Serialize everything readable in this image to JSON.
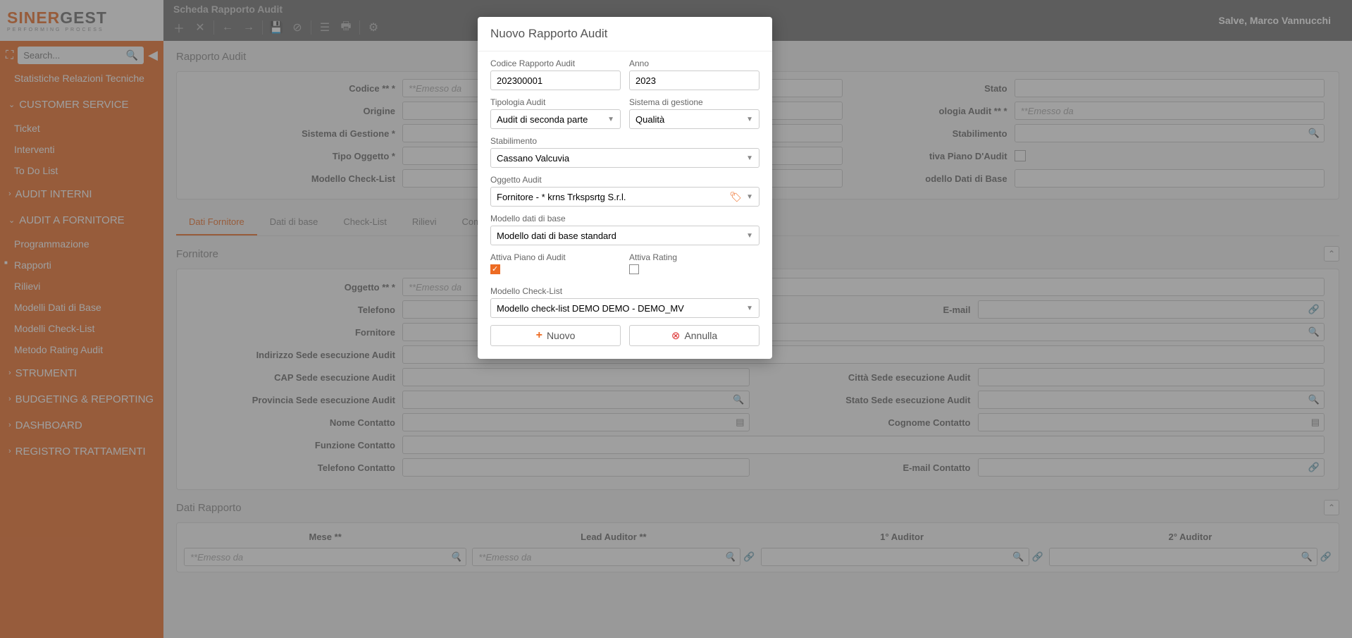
{
  "logo": {
    "part1": "SINER",
    "part2": "GEST",
    "sub": "PERFORMING PROCESS"
  },
  "search_placeholder": "Search...",
  "greeting": "Salve, Marco Vannucchi",
  "topbar_title": "Scheda Rapporto Audit",
  "page_title": "Rapporto Audit",
  "sidebar": {
    "stat_rel": "Statistiche Relazioni Tecniche",
    "sections": [
      {
        "title": "CUSTOMER SERVICE",
        "open": true,
        "items": [
          "Ticket",
          "Interventi",
          "To Do List"
        ]
      },
      {
        "title": "AUDIT INTERNI",
        "open": false,
        "items": []
      },
      {
        "title": "AUDIT A FORNITORE",
        "open": true,
        "items": [
          "Programmazione",
          "Rapporti",
          "Rilievi",
          "Modelli Dati di Base",
          "Modelli Check-List",
          "Metodo Rating Audit"
        ],
        "active": "Rapporti"
      },
      {
        "title": "STRUMENTI",
        "open": false,
        "items": []
      },
      {
        "title": "BUDGETING & REPORTING",
        "open": false,
        "items": []
      },
      {
        "title": "DASHBOARD",
        "open": false,
        "items": []
      },
      {
        "title": "REGISTRO TRATTAMENTI",
        "open": false,
        "items": []
      }
    ]
  },
  "form1": {
    "codice_label": "Codice ** *",
    "codice_ph": "**Emesso da",
    "origine_label": "Origine",
    "sistema_label": "Sistema di Gestione *",
    "tipo_oggetto_label": "Tipo Oggetto *",
    "modello_cl_label": "Modello Check-List",
    "stato_label": "Stato",
    "tipologia_label": "ologia Audit ** *",
    "tipologia_ph": "**Emesso da",
    "stabilimento_label": "Stabilimento",
    "attiva_piano_label": "tiva Piano D'Audit",
    "modello_dati_label": "odello Dati di Base"
  },
  "tabs": [
    "Dati Fornitore",
    "Dati di base",
    "Check-List",
    "Rilievi",
    "Comunicazioni"
  ],
  "active_tab": "Dati Fornitore",
  "fornitore_section": {
    "title": "Fornitore",
    "oggetto_label": "Oggetto ** *",
    "oggetto_ph": "**Emesso da",
    "telefono_label": "Telefono",
    "email_label": "E-mail",
    "fornitore_label": "Fornitore",
    "indirizzo_label": "Indirizzo Sede esecuzione Audit",
    "cap_label": "CAP Sede esecuzione Audit",
    "citta_label": "Città Sede esecuzione Audit",
    "provincia_label": "Provincia Sede esecuzione Audit",
    "stato_sede_label": "Stato Sede esecuzione Audit",
    "nome_contatto_label": "Nome Contatto",
    "cognome_contatto_label": "Cognome Contatto",
    "funzione_label": "Funzione Contatto",
    "telefono_contatto_label": "Telefono Contatto",
    "email_contatto_label": "E-mail Contatto"
  },
  "dati_rapporto": {
    "title": "Dati Rapporto",
    "cols": [
      "Mese **",
      "Lead Auditor **",
      "1° Auditor",
      "2° Auditor"
    ],
    "ph": "**Emesso da"
  },
  "modal": {
    "title": "Nuovo Rapporto Audit",
    "codice_label": "Codice Rapporto Audit",
    "codice_val": "202300001",
    "anno_label": "Anno",
    "anno_val": "2023",
    "tipologia_label": "Tipologia Audit",
    "tipologia_val": "Audit di seconda parte",
    "sistema_label": "Sistema di gestione",
    "sistema_val": "Qualità",
    "stabilimento_label": "Stabilimento",
    "stabilimento_val": "Cassano Valcuvia",
    "oggetto_label": "Oggetto Audit",
    "oggetto_val": "Fornitore - * krns Trkspsrtg S.r.l.",
    "modello_dati_label": "Modello dati di base",
    "modello_dati_val": "Modello dati di base standard",
    "attiva_piano_label": "Attiva Piano di Audit",
    "attiva_piano_checked": true,
    "attiva_rating_label": "Attiva Rating",
    "attiva_rating_checked": false,
    "modello_cl_label": "Modello Check-List",
    "modello_cl_val": "Modello check-list DEMO DEMO - DEMO_MV",
    "btn_nuovo": "Nuovo",
    "btn_annulla": "Annulla"
  }
}
